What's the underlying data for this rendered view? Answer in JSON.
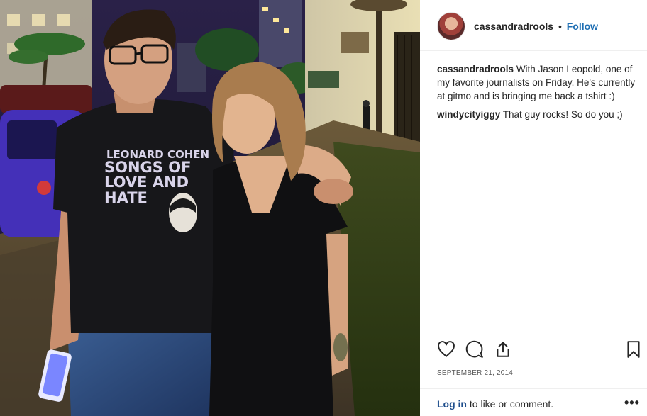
{
  "post": {
    "username": "cassandradrools",
    "separator": "•",
    "follow_label": "Follow",
    "comments": [
      {
        "user": "cassandradrools",
        "text": "With Jason Leopold, one of my favorite journalists on Friday. He's currently at gitmo and is bringing me back a tshirt :)"
      },
      {
        "user": "windycityiggy",
        "text": "That guy rocks! So do you ;)"
      }
    ],
    "date": "SEPTEMBER 21, 2014",
    "login_link": "Log in",
    "login_rest": " to like or comment.",
    "more_label": "•••",
    "icons": [
      "heart-icon",
      "comment-icon",
      "share-icon",
      "bookmark-icon"
    ]
  },
  "photo": {
    "shirt_text": [
      "LEONARD COHEN",
      "SONGS OF",
      "LOVE AND",
      "HATE"
    ]
  }
}
